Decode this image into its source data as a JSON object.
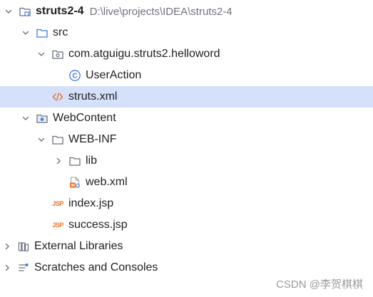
{
  "tree": {
    "root": {
      "label": "struts2-4",
      "path": "D:\\live\\projects\\IDEA\\struts2-4",
      "icon": "module-folder-icon",
      "expanded": true
    },
    "src": {
      "label": "src",
      "icon": "source-folder-icon",
      "expanded": true
    },
    "package": {
      "label": "com.atguigu.struts2.helloword",
      "icon": "package-icon",
      "expanded": true
    },
    "user_action": {
      "label": "UserAction",
      "icon": "class-icon",
      "badge": "C"
    },
    "struts_xml": {
      "label": "struts.xml",
      "icon": "xml-file-icon",
      "selected": true
    },
    "web_content": {
      "label": "WebContent",
      "icon": "web-folder-icon",
      "expanded": true
    },
    "web_inf": {
      "label": "WEB-INF",
      "icon": "folder-icon",
      "expanded": true
    },
    "lib": {
      "label": "lib",
      "icon": "folder-icon",
      "expanded": false
    },
    "web_xml": {
      "label": "web.xml",
      "icon": "web-xml-icon"
    },
    "index_jsp": {
      "label": "index.jsp",
      "icon": "jsp-file-icon",
      "badge": "JSP"
    },
    "success_jsp": {
      "label": "success.jsp",
      "icon": "jsp-file-icon",
      "badge": "JSP"
    },
    "external_libraries": {
      "label": "External Libraries",
      "icon": "libraries-icon",
      "expanded": false
    },
    "scratches": {
      "label": "Scratches and Consoles",
      "icon": "scratches-icon",
      "expanded": false
    }
  },
  "watermark": "CSDN @李贺棋棋",
  "colors": {
    "selection": "#d5e1fb",
    "class_icon": "#3d7be8",
    "xml_icon": "#e8742a",
    "jsp_icon": "#e8742a",
    "path_text": "#6f737a"
  }
}
